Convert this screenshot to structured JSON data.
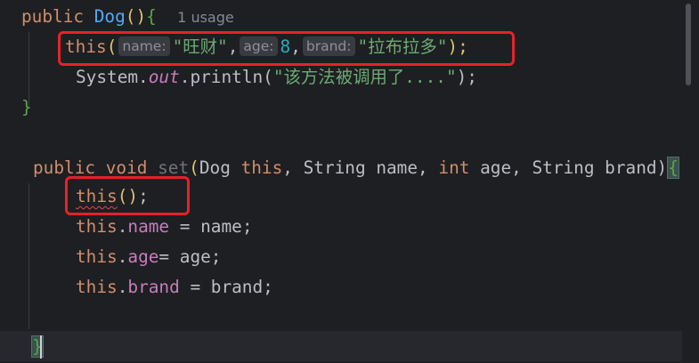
{
  "code": {
    "line1": {
      "kw_public": "public",
      "fn_name": "Dog",
      "parens": "()",
      "brace_open": "{",
      "usage_hint": "1 usage"
    },
    "line2": {
      "kw_this": "this",
      "paren_open": "(",
      "hint_name": "name:",
      "str_name": "\"旺财\"",
      "comma1": ",",
      "hint_age": "age:",
      "num_age": "8",
      "comma2": ",",
      "hint_brand": "brand:",
      "str_brand": "\"拉布拉多\"",
      "paren_close_semi": ");"
    },
    "line3": {
      "system": "System.",
      "out": "out",
      "println": ".println(",
      "str_msg": "\"该方法被调用了....\"",
      "close": ");"
    },
    "line4": {
      "brace_close": "}"
    },
    "line6": {
      "kw_public": "public",
      "kw_void": "void",
      "fn_set": "set",
      "paren_open": "(",
      "type_dog": "Dog",
      "kw_this": "this",
      "sep1": ", String name, ",
      "kw_int": "int",
      "sep2": " age, String brand)",
      "brace_open": "{"
    },
    "line7": {
      "kw_this": "this",
      "parens": "()",
      "semi": ";"
    },
    "line8": {
      "kw_this": "this",
      "dot": ".",
      "field": "name",
      "rest": " = name;"
    },
    "line9": {
      "kw_this": "this",
      "dot": ".",
      "field": "age",
      "rest": "= age;"
    },
    "line10": {
      "kw_this": "this",
      "dot": ".",
      "field": "brand",
      "rest": " = brand;"
    },
    "line12": {
      "brace_close": "}"
    }
  },
  "colors": {
    "background": "#1e1f22",
    "keyword": "#cf8e6d",
    "function": "#56a8f5",
    "string": "#6aab73",
    "number": "#2aacb8",
    "field": "#c77dbb",
    "annotation_box": "#e5222b"
  }
}
